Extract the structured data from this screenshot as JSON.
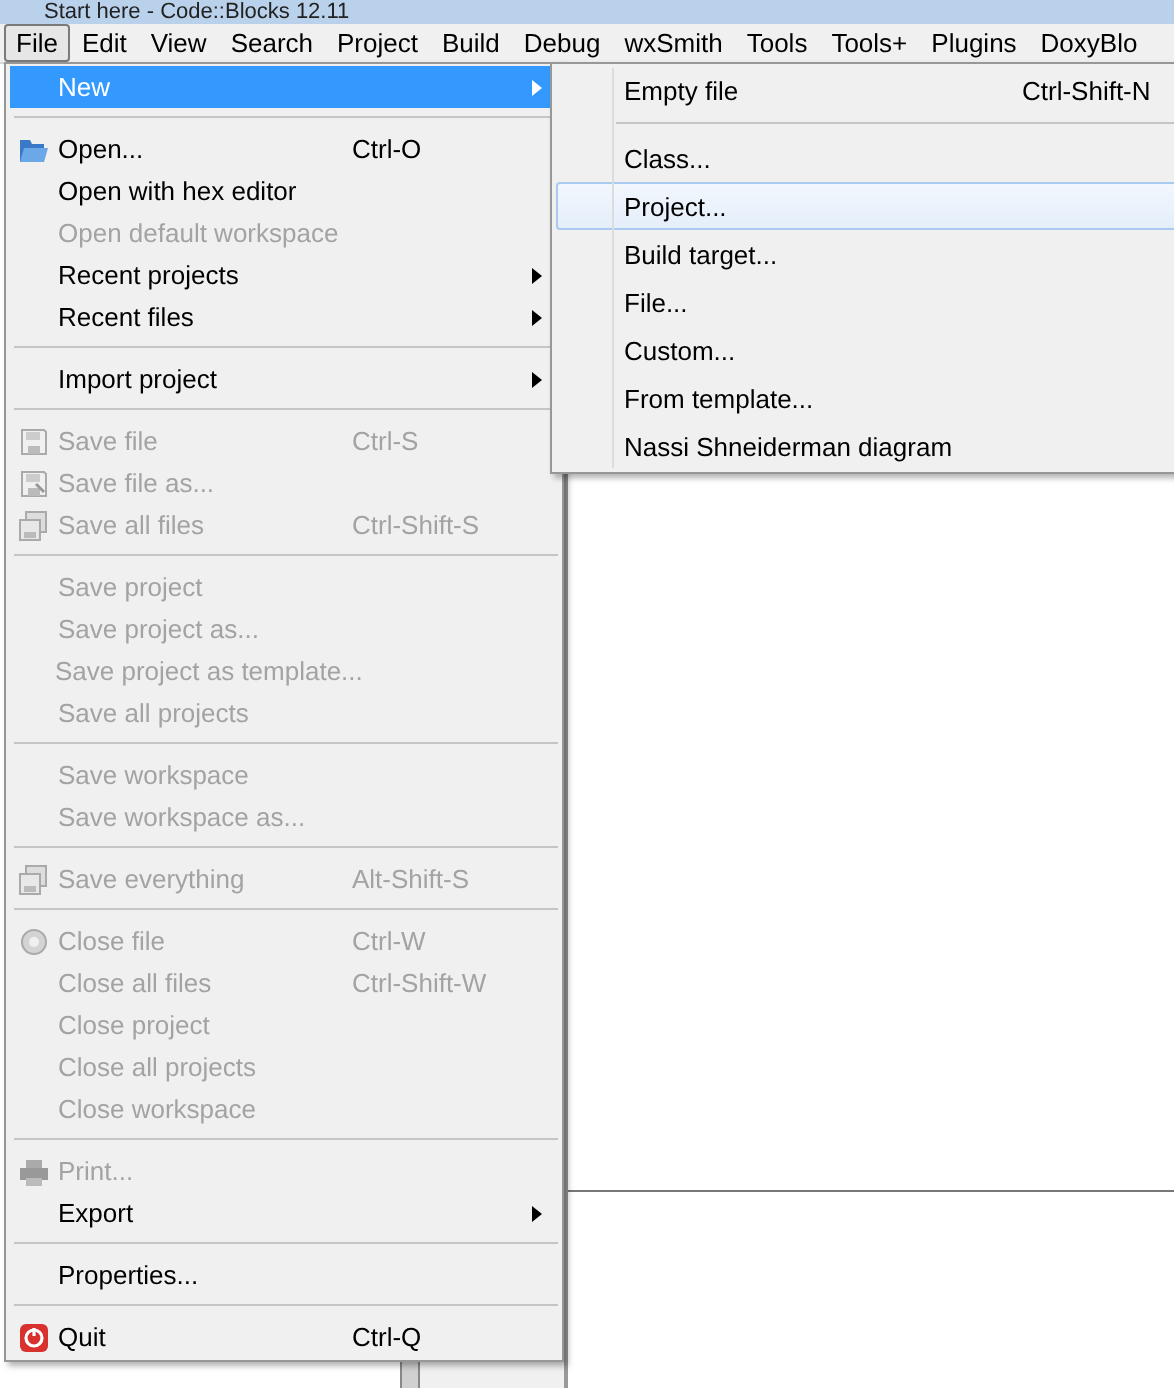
{
  "window": {
    "title": "Start here - Code::Blocks 12.11"
  },
  "menubar": [
    {
      "label": "File",
      "selected": true
    },
    {
      "label": "Edit",
      "selected": false
    },
    {
      "label": "View",
      "selected": false
    },
    {
      "label": "Search",
      "selected": false
    },
    {
      "label": "Project",
      "selected": false
    },
    {
      "label": "Build",
      "selected": false
    },
    {
      "label": "Debug",
      "selected": false
    },
    {
      "label": "wxSmith",
      "selected": false
    },
    {
      "label": "Tools",
      "selected": false
    },
    {
      "label": "Tools+",
      "selected": false
    },
    {
      "label": "Plugins",
      "selected": false
    },
    {
      "label": "DoxyBlo",
      "selected": false
    }
  ],
  "file_menu": [
    {
      "kind": "item",
      "label": "New",
      "selected": true,
      "disabled": false,
      "submenu": true
    },
    {
      "kind": "separator"
    },
    {
      "kind": "item",
      "label": "Open...",
      "shortcut": "Ctrl-O",
      "selected": false,
      "disabled": false,
      "submenu": false
    },
    {
      "kind": "item",
      "label": "Open with hex editor",
      "selected": false,
      "disabled": false,
      "submenu": false
    },
    {
      "kind": "item",
      "label": "Open default workspace",
      "selected": false,
      "disabled": true,
      "submenu": false
    },
    {
      "kind": "item",
      "label": "Recent projects",
      "selected": false,
      "disabled": false,
      "submenu": true
    },
    {
      "kind": "item",
      "label": "Recent files",
      "selected": false,
      "disabled": false,
      "submenu": true
    },
    {
      "kind": "separator"
    },
    {
      "kind": "item",
      "label": "Import project",
      "selected": false,
      "disabled": false,
      "submenu": true
    },
    {
      "kind": "separator"
    },
    {
      "kind": "item",
      "label": "Save file",
      "shortcut": "Ctrl-S",
      "selected": false,
      "disabled": true,
      "submenu": false
    },
    {
      "kind": "item",
      "label": "Save file as...",
      "selected": false,
      "disabled": true,
      "submenu": false
    },
    {
      "kind": "item",
      "label": "Save all files",
      "shortcut": "Ctrl-Shift-S",
      "selected": false,
      "disabled": true,
      "submenu": false
    },
    {
      "kind": "separator"
    },
    {
      "kind": "item",
      "label": "Save project",
      "selected": false,
      "disabled": true,
      "submenu": false
    },
    {
      "kind": "item",
      "label": "Save project as...",
      "selected": false,
      "disabled": true,
      "submenu": false
    },
    {
      "kind": "item",
      "label": "Save project as template...",
      "selected": false,
      "disabled": true,
      "submenu": false
    },
    {
      "kind": "item",
      "label": "Save all projects",
      "selected": false,
      "disabled": true,
      "submenu": false
    },
    {
      "kind": "separator"
    },
    {
      "kind": "item",
      "label": "Save workspace",
      "selected": false,
      "disabled": true,
      "submenu": false
    },
    {
      "kind": "item",
      "label": "Save workspace as...",
      "selected": false,
      "disabled": true,
      "submenu": false
    },
    {
      "kind": "separator"
    },
    {
      "kind": "item",
      "label": "Save everything",
      "shortcut": "Alt-Shift-S",
      "selected": false,
      "disabled": true,
      "submenu": false
    },
    {
      "kind": "separator"
    },
    {
      "kind": "item",
      "label": "Close file",
      "shortcut": "Ctrl-W",
      "selected": false,
      "disabled": true,
      "submenu": false
    },
    {
      "kind": "item",
      "label": "Close all files",
      "shortcut": "Ctrl-Shift-W",
      "selected": false,
      "disabled": true,
      "submenu": false
    },
    {
      "kind": "item",
      "label": "Close project",
      "selected": false,
      "disabled": true,
      "submenu": false
    },
    {
      "kind": "item",
      "label": "Close all projects",
      "selected": false,
      "disabled": true,
      "submenu": false
    },
    {
      "kind": "item",
      "label": "Close workspace",
      "selected": false,
      "disabled": true,
      "submenu": false
    },
    {
      "kind": "separator"
    },
    {
      "kind": "item",
      "label": "Print...",
      "selected": false,
      "disabled": true,
      "submenu": false
    },
    {
      "kind": "item",
      "label": "Export",
      "selected": false,
      "disabled": false,
      "submenu": true
    },
    {
      "kind": "separator"
    },
    {
      "kind": "item",
      "label": "Properties...",
      "selected": false,
      "disabled": false,
      "submenu": false
    },
    {
      "kind": "separator"
    },
    {
      "kind": "item",
      "label": "Quit",
      "shortcut": "Ctrl-Q",
      "selected": false,
      "disabled": false,
      "submenu": false
    }
  ],
  "new_submenu": [
    {
      "kind": "item",
      "label": "Empty file",
      "shortcut": "Ctrl-Shift-N",
      "selected": false
    },
    {
      "kind": "separator"
    },
    {
      "kind": "item",
      "label": "Class...",
      "selected": false
    },
    {
      "kind": "item",
      "label": "Project...",
      "selected": true
    },
    {
      "kind": "item",
      "label": "Build target...",
      "selected": false
    },
    {
      "kind": "item",
      "label": "File...",
      "selected": false
    },
    {
      "kind": "item",
      "label": "Custom...",
      "selected": false
    },
    {
      "kind": "item",
      "label": "From template...",
      "selected": false
    },
    {
      "kind": "item",
      "label": "Nassi Shneiderman diagram",
      "selected": false
    }
  ]
}
